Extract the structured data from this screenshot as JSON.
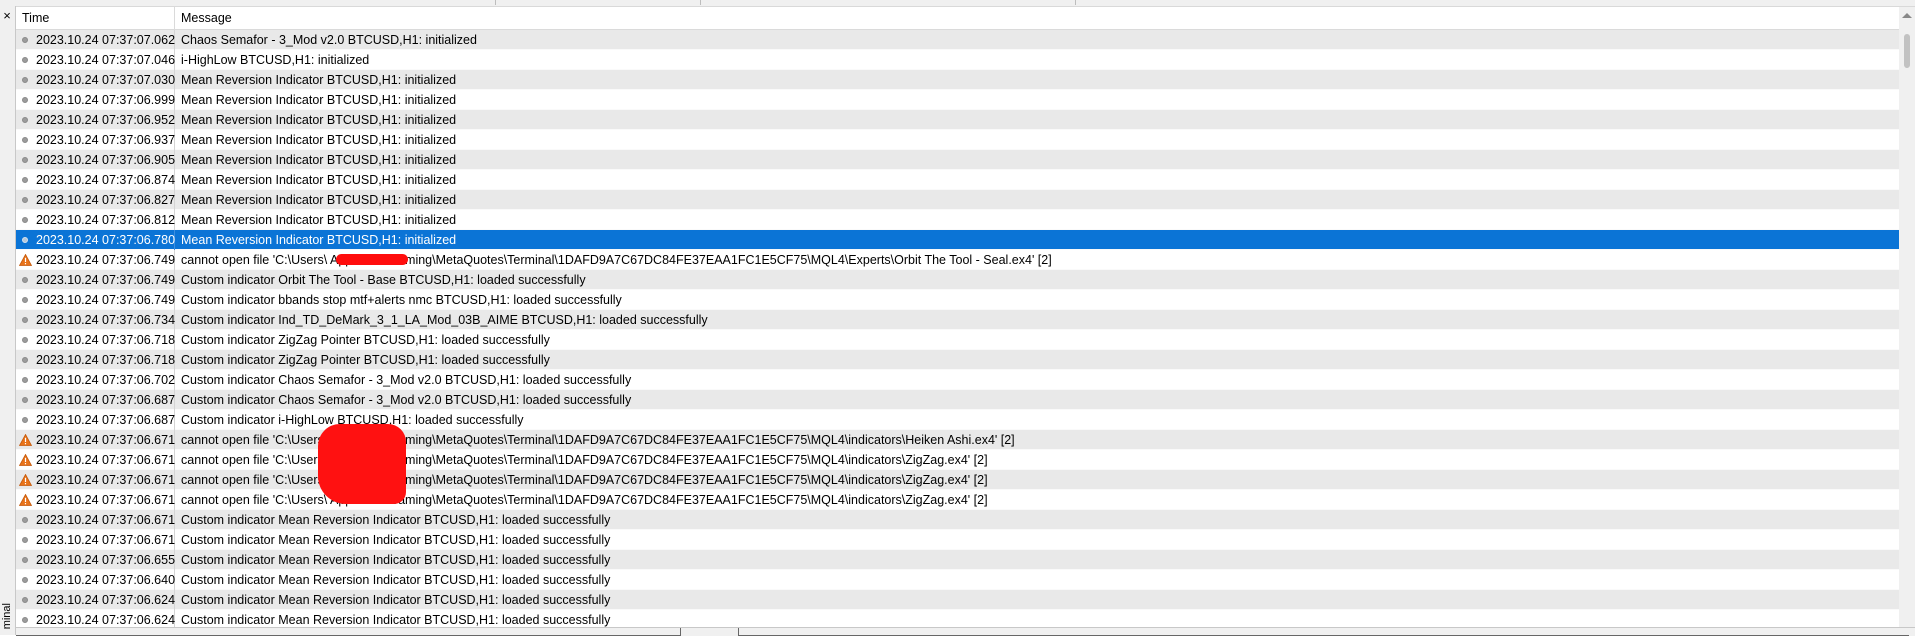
{
  "window": {
    "close_glyph": "×",
    "panel_label": "minal"
  },
  "columns": {
    "time": "Time",
    "message": "Message"
  },
  "colors": {
    "selected_row": "#0b74d6",
    "alt_row": "#e9e9e9",
    "redaction": "#ff0d0d"
  },
  "rows": [
    {
      "icon": "info",
      "time": "2023.10.24 07:37:07.062",
      "message": "Chaos Semafor - 3_Mod v2.0 BTCUSD,H1: initialized"
    },
    {
      "icon": "info",
      "time": "2023.10.24 07:37:07.046",
      "message": "i-HighLow BTCUSD,H1: initialized"
    },
    {
      "icon": "info",
      "time": "2023.10.24 07:37:07.030",
      "message": "Mean Reversion Indicator BTCUSD,H1: initialized"
    },
    {
      "icon": "info",
      "time": "2023.10.24 07:37:06.999",
      "message": "Mean Reversion Indicator BTCUSD,H1: initialized"
    },
    {
      "icon": "info",
      "time": "2023.10.24 07:37:06.952",
      "message": "Mean Reversion Indicator BTCUSD,H1: initialized"
    },
    {
      "icon": "info",
      "time": "2023.10.24 07:37:06.937",
      "message": "Mean Reversion Indicator BTCUSD,H1: initialized"
    },
    {
      "icon": "info",
      "time": "2023.10.24 07:37:06.905",
      "message": "Mean Reversion Indicator BTCUSD,H1: initialized"
    },
    {
      "icon": "info",
      "time": "2023.10.24 07:37:06.874",
      "message": "Mean Reversion Indicator BTCUSD,H1: initialized"
    },
    {
      "icon": "info",
      "time": "2023.10.24 07:37:06.827",
      "message": "Mean Reversion Indicator BTCUSD,H1: initialized"
    },
    {
      "icon": "info",
      "time": "2023.10.24 07:37:06.812",
      "message": "Mean Reversion Indicator BTCUSD,H1: initialized"
    },
    {
      "icon": "info",
      "time": "2023.10.24 07:37:06.780",
      "message": "Mean Reversion Indicator BTCUSD,H1: initialized",
      "selected": true
    },
    {
      "icon": "warning",
      "time": "2023.10.24 07:37:06.749",
      "message": "cannot open file 'C:\\Users\\                              AppData\\Roaming\\MetaQuotes\\Terminal\\1DAFD9A7C67DC84FE37EAA1FC1E5CF75\\MQL4\\Experts\\Orbit The Tool - Seal.ex4' [2]"
    },
    {
      "icon": "info",
      "time": "2023.10.24 07:37:06.749",
      "message": "Custom indicator Orbit The Tool - Base BTCUSD,H1: loaded successfully"
    },
    {
      "icon": "info",
      "time": "2023.10.24 07:37:06.749",
      "message": "Custom indicator bbands stop mtf+alerts nmc BTCUSD,H1: loaded successfully"
    },
    {
      "icon": "info",
      "time": "2023.10.24 07:37:06.734",
      "message": "Custom indicator Ind_TD_DeMark_3_1_LA_Mod_03B_AIME BTCUSD,H1: loaded successfully"
    },
    {
      "icon": "info",
      "time": "2023.10.24 07:37:06.718",
      "message": "Custom indicator ZigZag Pointer BTCUSD,H1: loaded successfully"
    },
    {
      "icon": "info",
      "time": "2023.10.24 07:37:06.718",
      "message": "Custom indicator ZigZag Pointer BTCUSD,H1: loaded successfully"
    },
    {
      "icon": "info",
      "time": "2023.10.24 07:37:06.702",
      "message": "Custom indicator Chaos Semafor - 3_Mod v2.0 BTCUSD,H1: loaded successfully"
    },
    {
      "icon": "info",
      "time": "2023.10.24 07:37:06.687",
      "message": "Custom indicator Chaos Semafor - 3_Mod v2.0 BTCUSD,H1: loaded successfully"
    },
    {
      "icon": "info",
      "time": "2023.10.24 07:37:06.687",
      "message": "Custom indicator i-HighLow BTCUSD,H1: loaded successfully"
    },
    {
      "icon": "warning",
      "time": "2023.10.24 07:37:06.671",
      "message": "cannot open file 'C:\\Users\\                        AppData\\Roaming\\MetaQuotes\\Terminal\\1DAFD9A7C67DC84FE37EAA1FC1E5CF75\\MQL4\\indicators\\Heiken Ashi.ex4' [2]"
    },
    {
      "icon": "warning",
      "time": "2023.10.24 07:37:06.671",
      "message": "cannot open file 'C:\\Users\\                        AppData\\Roaming\\MetaQuotes\\Terminal\\1DAFD9A7C67DC84FE37EAA1FC1E5CF75\\MQL4\\indicators\\ZigZag.ex4' [2]"
    },
    {
      "icon": "warning",
      "time": "2023.10.24 07:37:06.671",
      "message": "cannot open file 'C:\\Users\\                        AppData\\Roaming\\MetaQuotes\\Terminal\\1DAFD9A7C67DC84FE37EAA1FC1E5CF75\\MQL4\\indicators\\ZigZag.ex4' [2]"
    },
    {
      "icon": "warning",
      "time": "2023.10.24 07:37:06.671",
      "message": "cannot open file 'C:\\Users\\                        AppData\\Roaming\\MetaQuotes\\Terminal\\1DAFD9A7C67DC84FE37EAA1FC1E5CF75\\MQL4\\indicators\\ZigZag.ex4' [2]"
    },
    {
      "icon": "info",
      "time": "2023.10.24 07:37:06.671",
      "message": "Custom indicator Mean Reversion Indicator BTCUSD,H1: loaded successfully"
    },
    {
      "icon": "info",
      "time": "2023.10.24 07:37:06.671",
      "message": "Custom indicator Mean Reversion Indicator BTCUSD,H1: loaded successfully"
    },
    {
      "icon": "info",
      "time": "2023.10.24 07:37:06.655",
      "message": "Custom indicator Mean Reversion Indicator BTCUSD,H1: loaded successfully"
    },
    {
      "icon": "info",
      "time": "2023.10.24 07:37:06.640",
      "message": "Custom indicator Mean Reversion Indicator BTCUSD,H1: loaded successfully"
    },
    {
      "icon": "info",
      "time": "2023.10.24 07:37:06.624",
      "message": "Custom indicator Mean Reversion Indicator BTCUSD,H1: loaded successfully"
    },
    {
      "icon": "info",
      "time": "2023.10.24 07:37:06.624",
      "message": "Custom indicator Mean Reversion Indicator BTCUSD,H1: loaded successfully"
    }
  ]
}
